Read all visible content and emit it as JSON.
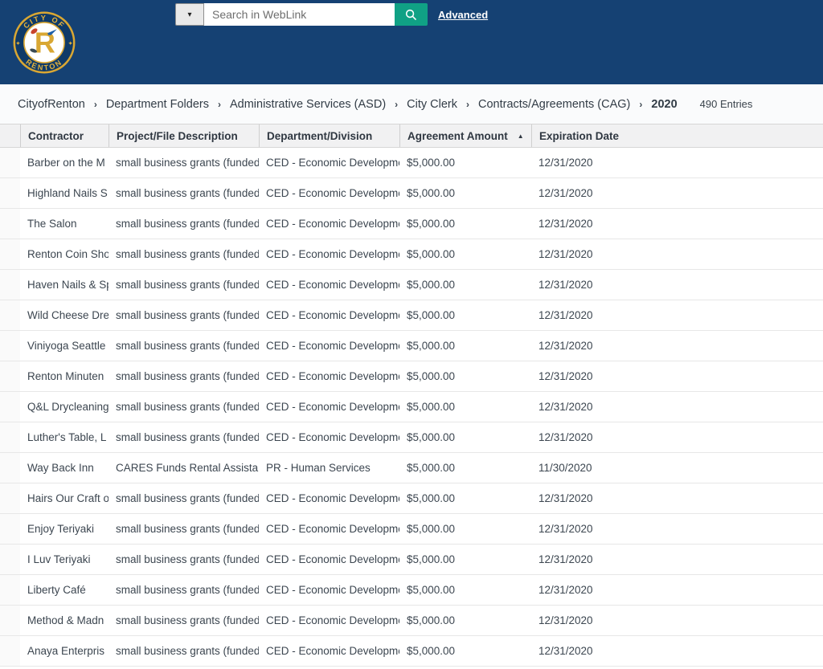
{
  "header": {
    "logo": {
      "top_text": "CITY OF",
      "bottom_text": "RENTON",
      "monogram": "R"
    },
    "search": {
      "placeholder": "Search in WebLink",
      "dropdown_caret": "▾",
      "advanced_label": "Advanced"
    },
    "colors": {
      "topbar": "#154173",
      "search_button": "#10a185",
      "logo_gold": "#d9a733",
      "logo_navy": "#0f3a68"
    }
  },
  "breadcrumb": {
    "separator": "›",
    "items": [
      {
        "label": "CityofRenton"
      },
      {
        "label": "Department Folders"
      },
      {
        "label": "Administrative Services (ASD)"
      },
      {
        "label": "City Clerk"
      },
      {
        "label": "Contracts/Agreements (CAG)"
      },
      {
        "label": "2020"
      }
    ],
    "entries_count": "490 Entries"
  },
  "table": {
    "columns": [
      {
        "label": "",
        "sort": ""
      },
      {
        "label": "Contractor",
        "sort": ""
      },
      {
        "label": "Project/File Description",
        "sort": ""
      },
      {
        "label": "Department/Division",
        "sort": ""
      },
      {
        "label": "Agreement Amount",
        "sort": "▲"
      },
      {
        "label": "Expiration Date",
        "sort": ""
      }
    ],
    "rows": [
      {
        "contractor": "Barber on the M",
        "description": "small business grants (funded",
        "department": "CED - Economic Developme",
        "amount": "$5,000.00",
        "expiration": "12/31/2020"
      },
      {
        "contractor": "Highland Nails S",
        "description": "small business grants (funded",
        "department": "CED - Economic Developme",
        "amount": "$5,000.00",
        "expiration": "12/31/2020"
      },
      {
        "contractor": "The Salon",
        "description": "small business grants (funded",
        "department": "CED - Economic Developme",
        "amount": "$5,000.00",
        "expiration": "12/31/2020"
      },
      {
        "contractor": "Renton Coin Sho",
        "description": "small business grants (funded",
        "department": "CED - Economic Developme",
        "amount": "$5,000.00",
        "expiration": "12/31/2020"
      },
      {
        "contractor": "Haven Nails & Sp",
        "description": "small business grants (funded",
        "department": "CED - Economic Developme",
        "amount": "$5,000.00",
        "expiration": "12/31/2020"
      },
      {
        "contractor": "Wild Cheese Dre",
        "description": "small business grants (funded",
        "department": "CED - Economic Developme",
        "amount": "$5,000.00",
        "expiration": "12/31/2020"
      },
      {
        "contractor": "Viniyoga Seattle",
        "description": "small business grants (funded",
        "department": "CED - Economic Developme",
        "amount": "$5,000.00",
        "expiration": "12/31/2020"
      },
      {
        "contractor": "Renton Minuten",
        "description": "small business grants (funded",
        "department": "CED - Economic Developme",
        "amount": "$5,000.00",
        "expiration": "12/31/2020"
      },
      {
        "contractor": "Q&L Drycleaning",
        "description": "small business grants (funded",
        "department": "CED - Economic Developme",
        "amount": "$5,000.00",
        "expiration": "12/31/2020"
      },
      {
        "contractor": "Luther's Table, L",
        "description": "small business grants (funded",
        "department": "CED - Economic Developme",
        "amount": "$5,000.00",
        "expiration": "12/31/2020"
      },
      {
        "contractor": "Way Back Inn",
        "description": "CARES Funds Rental Assistanc",
        "department": "PR - Human Services",
        "amount": "$5,000.00",
        "expiration": "11/30/2020"
      },
      {
        "contractor": "Hairs Our Craft o",
        "description": "small business grants (funded",
        "department": "CED - Economic Developme",
        "amount": "$5,000.00",
        "expiration": "12/31/2020"
      },
      {
        "contractor": "Enjoy Teriyaki",
        "description": "small business grants (funded",
        "department": "CED - Economic Developme",
        "amount": "$5,000.00",
        "expiration": "12/31/2020"
      },
      {
        "contractor": "I Luv Teriyaki",
        "description": "small business grants (funded",
        "department": "CED - Economic Developme",
        "amount": "$5,000.00",
        "expiration": "12/31/2020"
      },
      {
        "contractor": "Liberty Café",
        "description": "small business grants (funded",
        "department": "CED - Economic Developme",
        "amount": "$5,000.00",
        "expiration": "12/31/2020"
      },
      {
        "contractor": "Method & Madn",
        "description": "small business grants (funded",
        "department": "CED - Economic Developme",
        "amount": "$5,000.00",
        "expiration": "12/31/2020"
      },
      {
        "contractor": "Anaya Enterpris",
        "description": "small business grants (funded",
        "department": "CED - Economic Developme",
        "amount": "$5,000.00",
        "expiration": "12/31/2020"
      }
    ]
  }
}
